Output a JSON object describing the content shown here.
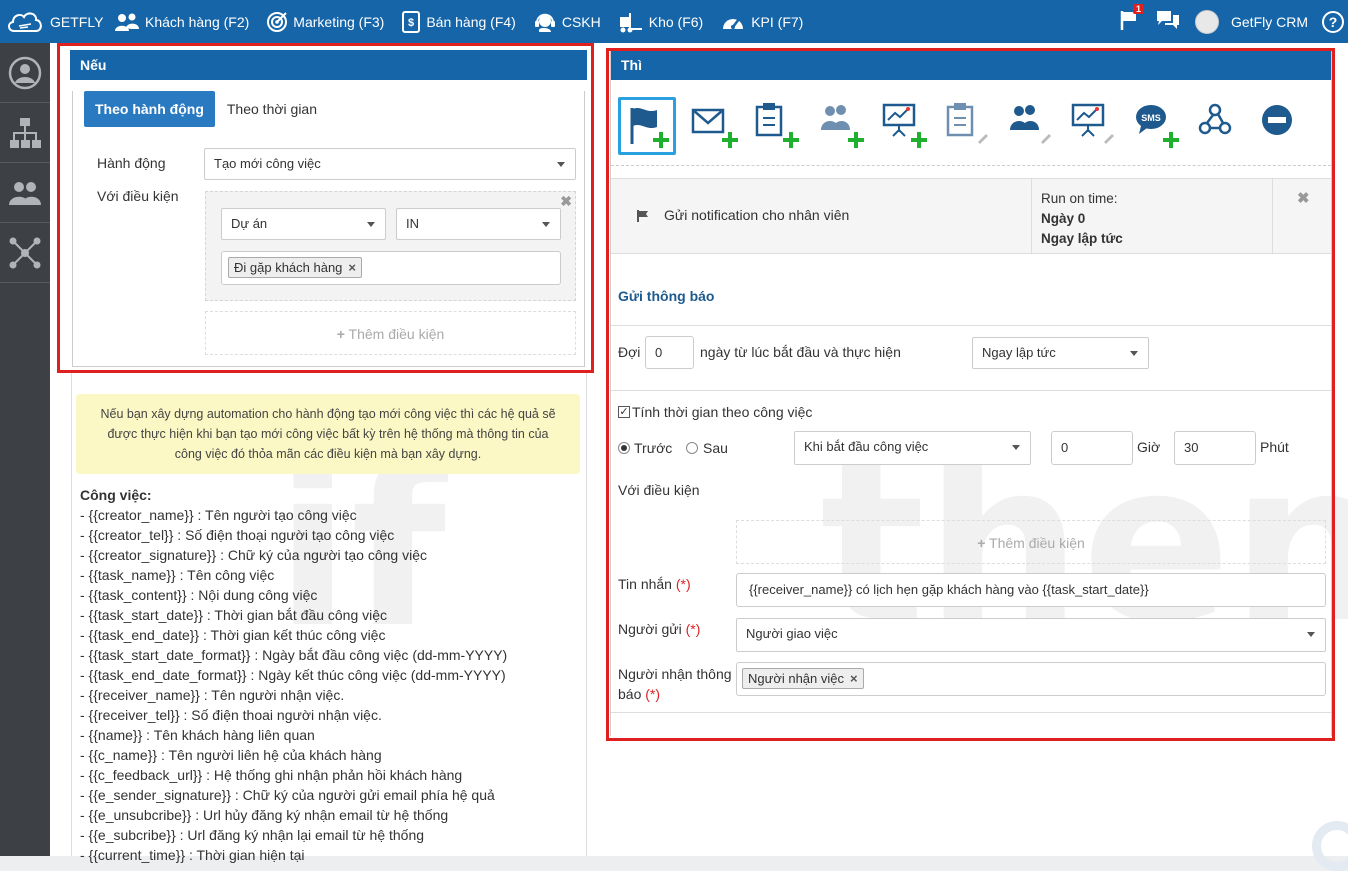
{
  "topbar": {
    "brand": "GETFLY",
    "nav": [
      {
        "label": "Khách hàng (F2)",
        "icon": "users-icon"
      },
      {
        "label": "Marketing (F3)",
        "icon": "target-icon"
      },
      {
        "label": "Bán hàng (F4)",
        "icon": "receipt-icon"
      },
      {
        "label": "CSKH",
        "icon": "headset-icon"
      },
      {
        "label": "Kho (F6)",
        "icon": "forklift-icon"
      },
      {
        "label": "KPI (F7)",
        "icon": "gauge-icon"
      }
    ],
    "flag_badge": "1",
    "account": "GetFly CRM",
    "help": "?"
  },
  "sidebar": [
    "user-icon",
    "org-chart-icon",
    "group-icon",
    "network-icon"
  ],
  "if_panel": {
    "title": "Nếu",
    "tab_action": "Theo hành động",
    "tab_time": "Theo thời gian",
    "action_label": "Hành động",
    "action_value": "Tạo mới công việc",
    "condition_label": "Với điều kiện",
    "cond_field": "Dự án",
    "cond_operator": "IN",
    "cond_tag": "Đi gặp khách hàng",
    "add_condition": "Thêm điều kiện",
    "info": "Nếu bạn xây dựng automation cho hành động tạo mới công việc thì các hệ quả sẽ được thực hiện khi bạn tạo mới công việc bất kỳ trên hệ thống mà thông tin của công việc đó thỏa mãn các điều kiện mà bạn xây dựng."
  },
  "variables": {
    "heading": "Công việc:",
    "items": [
      "- {{creator_name}} : Tên người tạo công việc",
      "- {{creator_tel}} : Số điện thoại người tạo công việc",
      "- {{creator_signature}} : Chữ ký của người tạo công việc",
      "- {{task_name}} : Tên công việc",
      "- {{task_content}} : Nội dung công việc",
      "- {{task_start_date}} : Thời gian bắt đầu công việc",
      "- {{task_end_date}} : Thời gian kết thúc công việc",
      "- {{task_start_date_format}} : Ngày bắt đầu công việc (dd-mm-YYYY)",
      "- {{task_end_date_format}} : Ngày kết thúc công việc (dd-mm-YYYY)",
      "- {{receiver_name}} : Tên người nhận việc.",
      "- {{receiver_tel}} : Số điện thoai người nhận việc.",
      "- {{name}} : Tên khách hàng liên quan",
      "- {{c_name}} : Tên người liên hệ của khách hàng",
      "- {{c_feedback_url}} : Hệ thống ghi nhận phản hồi khách hàng",
      "- {{e_sender_signature}} : Chữ ký của người gửi email phía hệ quả",
      "- {{e_unsubcribe}} : Url hủy đăng ký nhận email từ hệ thống",
      "- {{e_subcribe}} : Url đăng ký nhận lại email từ hệ thống",
      "- {{current_time}} : Thời gian hiện tại"
    ]
  },
  "then_panel": {
    "title": "Thì",
    "action_icons": [
      "flag-add-icon",
      "email-add-icon",
      "task-add-icon",
      "contact-add-icon",
      "presentation-add-icon",
      "task-edit-icon",
      "contact-edit-icon",
      "presentation-edit-icon",
      "sms-add-icon",
      "webhook-icon",
      "remove-icon"
    ],
    "sms_text": "SMS",
    "row_action": "Gửi notification cho nhân viên",
    "run_label": "Run on time:",
    "run_day": "Ngày 0",
    "run_when": "Ngay lập tức",
    "section_title": "Gửi thông báo",
    "wait_label": "Đợi",
    "wait_value": "0",
    "wait_suffix": "ngày từ lúc bắt đầu và thực hiện",
    "wait_select": "Ngay lập tức",
    "task_time_label": "Tính thời gian theo công việc",
    "before": "Trước",
    "after": "Sau",
    "task_time_select": "Khi bắt đầu công việc",
    "hours_value": "0",
    "hours_label": "Giờ",
    "minutes_value": "30",
    "minutes_label": "Phút",
    "condition_label": "Với điều kiện",
    "add_condition": "Thêm điều kiện",
    "message_label": "Tin nhắn",
    "message_value": "{{receiver_name}} có lịch hẹn gặp khách hàng vào {{task_start_date}}",
    "sender_label": "Người gửi",
    "sender_value": "Người giao việc",
    "receiver_label_1": "Người nhận thông",
    "receiver_label_2": "báo",
    "receiver_tag": "Người nhận việc",
    "required_mark": "(*)"
  },
  "watermark": {
    "left": "if",
    "right": "then"
  }
}
